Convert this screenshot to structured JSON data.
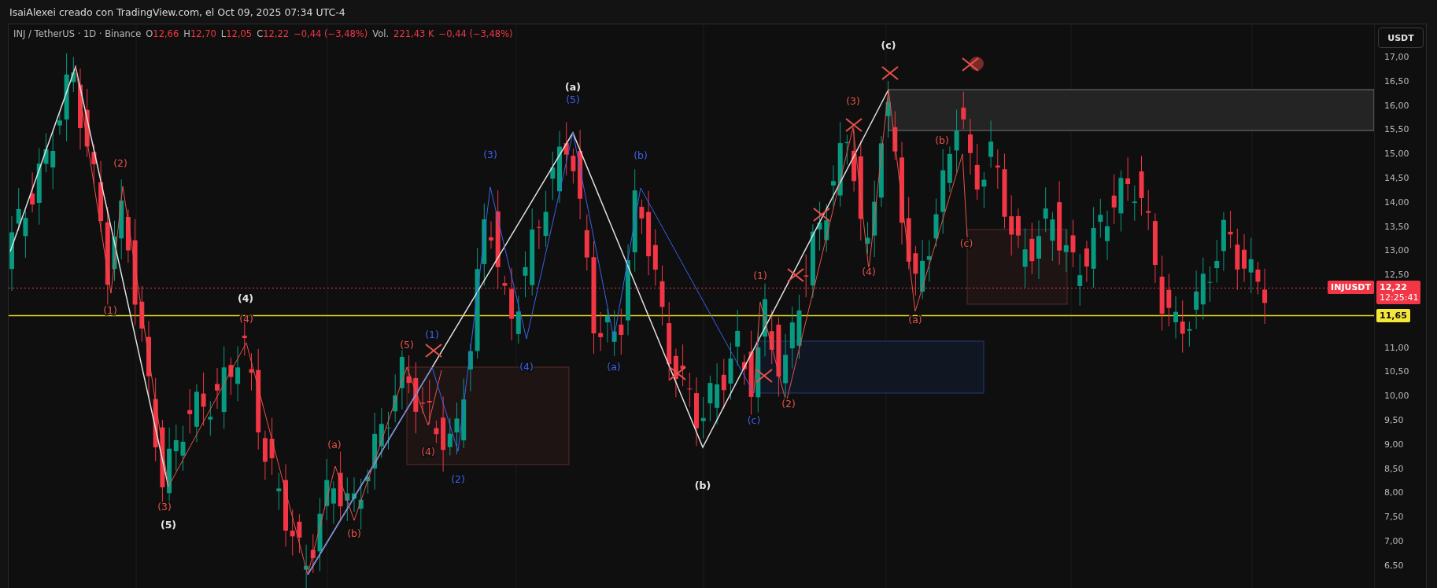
{
  "title_bar": {
    "text": "IsaiAlexei creado con TradingView.com, el Oct 09, 2025 07:34 UTC-4"
  },
  "legend": {
    "symbol": "INJ / TetherUS · 1D · Binance",
    "ohlc": [
      {
        "label": "O",
        "value": "12,66"
      },
      {
        "label": "H",
        "value": "12,70"
      },
      {
        "label": "L",
        "value": "12,05"
      },
      {
        "label": "C",
        "value": "12,22"
      }
    ],
    "change": "−0,44 (−3,48%)",
    "volume_label": "Vol.",
    "volume_value": "221,43 K",
    "volume_change": "−0,44 (−3,48%)"
  },
  "price_axis": {
    "currency_button": "USDT",
    "ticks_upper": [
      "17,00",
      "16,50",
      "16,00",
      "15,50",
      "15,00",
      "14,50",
      "14,00",
      "13,50",
      "13,00",
      "12,50"
    ],
    "ticks_lower": [
      "11,00",
      "10,50",
      "10,00",
      "9,50",
      "9,00",
      "8,50",
      "8,00",
      "7,50",
      "7,00",
      "6,50"
    ],
    "symbol_badge": "INJUSDT",
    "last_price": "12,22",
    "countdown": "12:25:41",
    "line_price": "11,65"
  },
  "wave_labels": [
    {
      "text": "(c)",
      "color": "#e6e6e6"
    },
    {
      "text": "(a)",
      "color": "#e6e6e6"
    },
    {
      "text": "(4)",
      "color": "#e6e6e6"
    },
    {
      "text": "(5)",
      "color": "#e6e6e6"
    },
    {
      "text": "(b)",
      "color": "#e6e6e6"
    },
    {
      "text": "(2)",
      "color": "#e5534b"
    },
    {
      "text": "(1)",
      "color": "#e5534b"
    },
    {
      "text": "(4)",
      "color": "#e5534b"
    },
    {
      "text": "(3)",
      "color": "#e5534b"
    },
    {
      "text": "(a)",
      "color": "#e5534b"
    },
    {
      "text": "(b)",
      "color": "#e5534b"
    },
    {
      "text": "(5)",
      "color": "#e5534b"
    },
    {
      "text": "(4)",
      "color": "#e5534b"
    },
    {
      "text": "(1)",
      "color": "#e5534b"
    },
    {
      "text": "(2)",
      "color": "#e5534b"
    },
    {
      "text": "(3)",
      "color": "#e5534b"
    },
    {
      "text": "(4)",
      "color": "#e5534b"
    },
    {
      "text": "(b)",
      "color": "#e5534b"
    },
    {
      "text": "(c)",
      "color": "#e5534b"
    },
    {
      "text": "(a)",
      "color": "#e5534b"
    },
    {
      "text": "(1)",
      "color": "#3b62e8"
    },
    {
      "text": "(2)",
      "color": "#3b62e8"
    },
    {
      "text": "(3)",
      "color": "#3b62e8"
    },
    {
      "text": "(4)",
      "color": "#3b62e8"
    },
    {
      "text": "(5)",
      "color": "#3b62e8"
    },
    {
      "text": "(a)",
      "color": "#3b62e8"
    },
    {
      "text": "(b)",
      "color": "#3b62e8"
    },
    {
      "text": "(c)",
      "color": "#3b62e8"
    }
  ]
}
